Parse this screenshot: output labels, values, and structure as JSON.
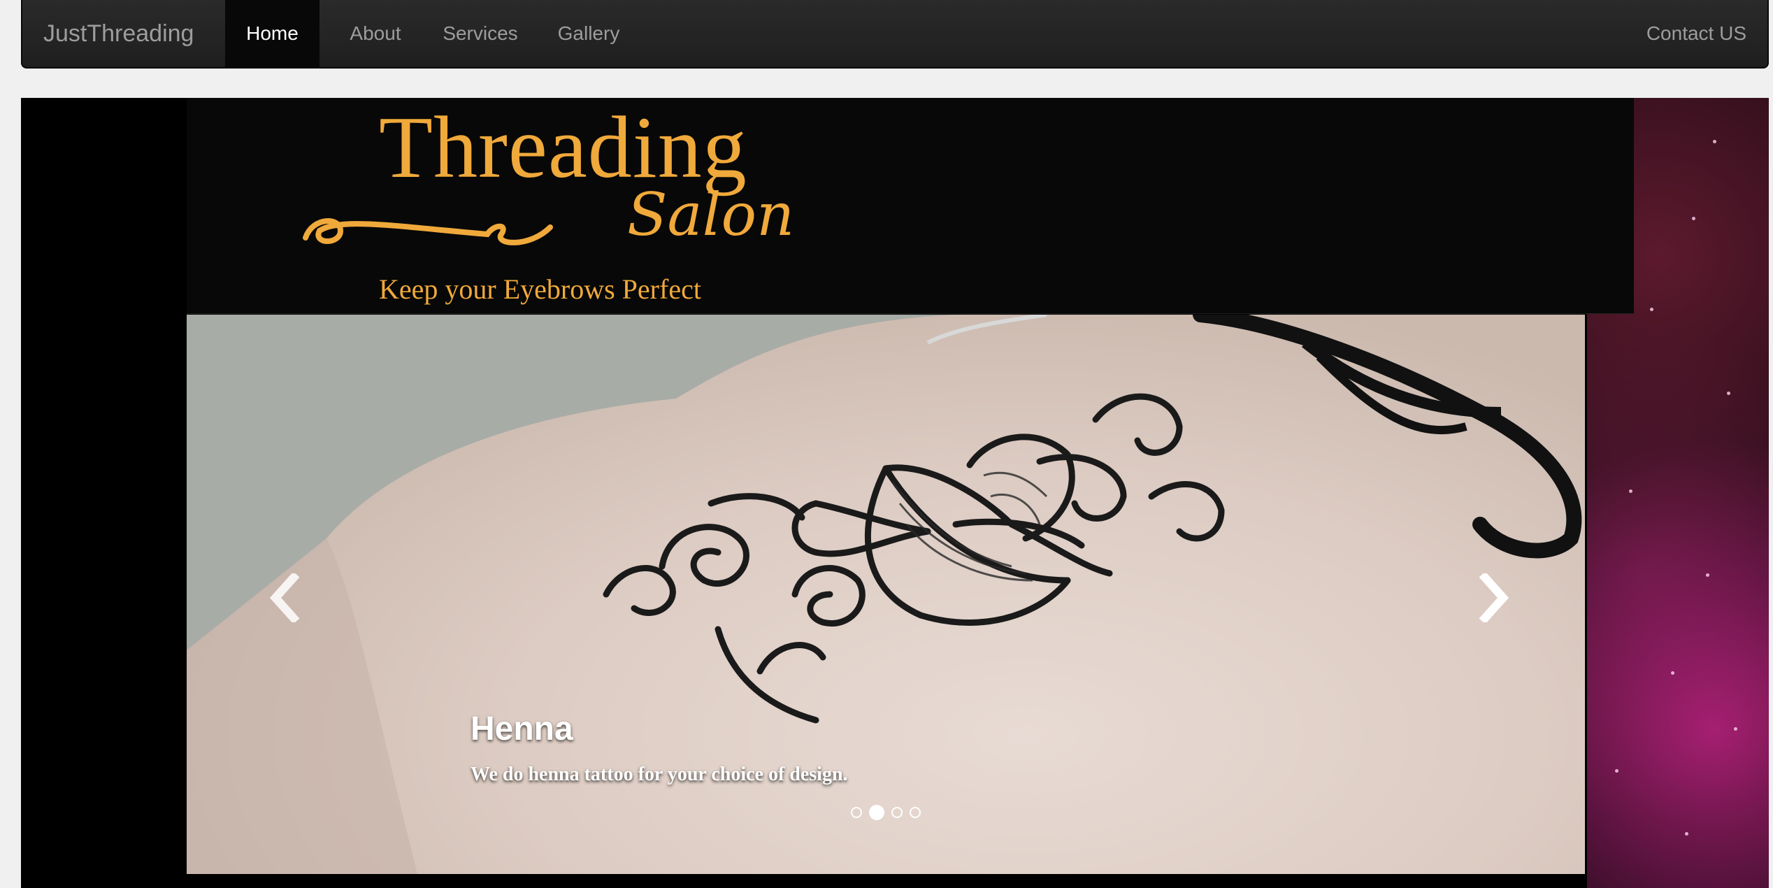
{
  "navbar": {
    "brand": "JustThreading",
    "items": [
      {
        "label": "Home",
        "active": true
      },
      {
        "label": "About"
      },
      {
        "label": "Services"
      },
      {
        "label": "Gallery"
      }
    ],
    "contact_label": "Contact US"
  },
  "banner": {
    "title": "Threading",
    "script": "Salon",
    "tagline": "Keep your Eyebrows Perfect"
  },
  "carousel": {
    "caption_title": "Henna",
    "caption_text": "We do henna tattoo for your choice of design.",
    "slide_count": 4,
    "active_index": 1,
    "prev_icon": "chevron-left-icon",
    "next_icon": "chevron-right-icon"
  },
  "colors": {
    "navbar_bg": "#222222",
    "nav_text": "#9d9d9d",
    "nav_active_bg": "#080808",
    "logo_gold": "#f0a93b"
  }
}
